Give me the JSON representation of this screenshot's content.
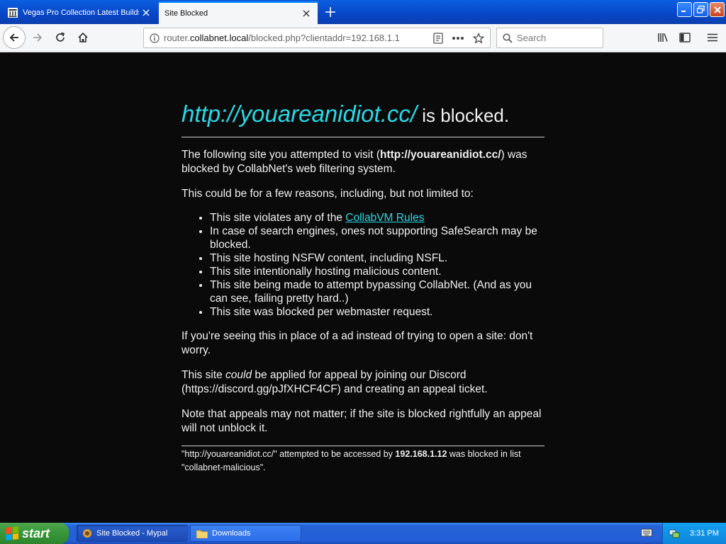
{
  "browser": {
    "tabs": [
      {
        "label": "Vegas Pro Collection Latest Builds",
        "active": false
      },
      {
        "label": "Site Blocked",
        "active": true
      }
    ],
    "url": {
      "prefix": "router.",
      "domain": "collabnet.local",
      "path": "/blocked.php?clientaddr=192.168.1.1"
    },
    "search_placeholder": "Search"
  },
  "page": {
    "heading_url": "http://youareanidiot.cc/",
    "heading_suffix": " is blocked.",
    "intro_before": "The following site you attempted to visit (",
    "intro_url": "http://youareanidiot.cc/",
    "intro_after": ") was blocked by CollabNet's web filtering system.",
    "reasons_intro": "This could be for a few reasons, including, but not limited to:",
    "reason_rules_prefix": "This site violates any of the ",
    "reason_rules_link": "CollabVM Rules",
    "reasons": [
      "In case of search engines, ones not supporting SafeSearch may be blocked.",
      "This site hosting NSFW content, including NSFL.",
      "This site intentionally hosting malicious content.",
      "This site being made to attempt bypassing CollabNet. (And as you can see, failing pretty hard..)",
      "This site was blocked per webmaster request."
    ],
    "ad_note": "If you're seeing this in place of a ad instead of trying to open a site: don't worry.",
    "appeal_before": "This site ",
    "appeal_em": "could",
    "appeal_after": " be applied for appeal by joining our Discord (https://discord.gg/pJfXHCF4CF) and creating an appeal ticket.",
    "appeal_note": "Note that appeals may not matter; if the site is blocked rightfully an appeal will not unblock it.",
    "footer_before": "\"http://youareanidiot.cc/\" attempted to be accessed by ",
    "footer_ip": "192.168.1.12",
    "footer_after": " was blocked in list \"collabnet-malicious\"."
  },
  "taskbar": {
    "start_label": "start",
    "items": [
      {
        "label": "Site Blocked - Mypal",
        "active": true
      },
      {
        "label": "Downloads",
        "active": false
      }
    ],
    "clock": "3:31 PM"
  },
  "colors": {
    "link": "#29d9e6",
    "page_bg": "#0a0a0a",
    "titlebar": "#0846c6"
  }
}
